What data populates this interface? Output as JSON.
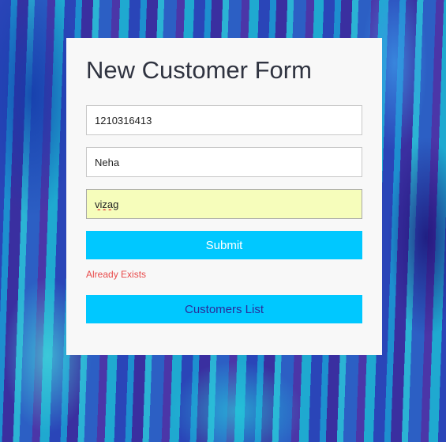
{
  "form": {
    "title": "New Customer Form",
    "fields": [
      {
        "value": "1210316413"
      },
      {
        "value": "Neha"
      },
      {
        "value": "vizag"
      }
    ],
    "submit_label": "Submit",
    "error_message": "Already Exists",
    "customers_list_label": "Customers List"
  },
  "colors": {
    "button_bg": "#00c8ff",
    "error": "#e84b4b",
    "active_field_bg": "#f6fdbb"
  }
}
